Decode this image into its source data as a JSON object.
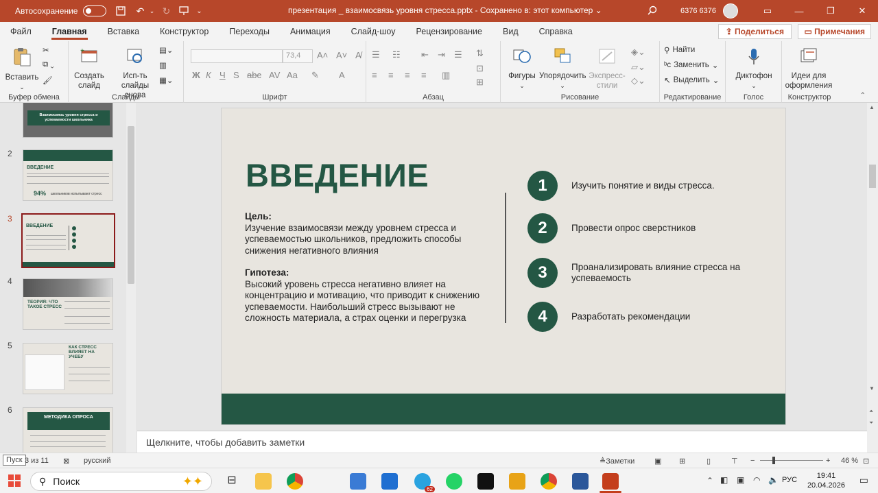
{
  "titlebar": {
    "autosave_label": "Автосохранение",
    "doc_title": "презентация _ взаимосвязь  уровня стресса.pptx  -  Сохранено в: этот компьютер ⌄",
    "user": "6376 6376"
  },
  "menu": {
    "tabs": [
      "Файл",
      "Главная",
      "Вставка",
      "Конструктор",
      "Переходы",
      "Анимация",
      "Слайд-шоу",
      "Рецензирование",
      "Вид",
      "Справка"
    ],
    "share": "Поделиться",
    "notes": "Примечания"
  },
  "ribbon": {
    "paste": "Вставить",
    "clipboard_group": "Буфер обмена",
    "new_slide": "Создать слайд",
    "reuse": "Исп-ть слайды снова",
    "slides_group": "Слайды",
    "font_size": "73,4",
    "font_group": "Шрифт",
    "paragraph_group": "Абзац",
    "shapes": "Фигуры",
    "arrange": "Упорядочить",
    "quick_styles": "Экспресс-стили",
    "drawing_group": "Рисование",
    "find": "Найти",
    "replace": "Заменить",
    "select": "Выделить",
    "editing_group": "Редактирование",
    "dictate": "Диктофон",
    "voice_group": "Голос",
    "designer": "Идеи для оформления",
    "designer_group": "Конструктор"
  },
  "thumbnails": {
    "slide1_title": "Взаимосвязь уровня стресса и успеваемости школьника",
    "slide2_title": "ВВЕДЕНИЕ",
    "slide2_stat": "94%",
    "slide2_stat_text": "школьников испытывают стресс",
    "slide3_title": "ВВЕДЕНИЕ",
    "slide4_title": "ТЕОРИЯ: ЧТО ТАКОЕ СТРЕСС",
    "slide5_title": "КАК СТРЕСС ВЛИЯЕТ НА УЧЕБУ",
    "slide6_title": "МЕТОДИКА ОПРОСА",
    "numbers": [
      "2",
      "3",
      "4",
      "5",
      "6"
    ]
  },
  "slide": {
    "title": "ВВЕДЕНИЕ",
    "goal_label": "Цель:",
    "goal_text": "Изучение взаимосвязи между уровнем стресса и успеваемостью школьников, предложить способы снижения негативного влияния",
    "hyp_label": "Гипотеза:",
    "hyp_text": "Высокий уровень стресса негативно влияет на концентрацию и мотивацию, что приводит к снижению успеваемости. Наибольший стресс вызывают не сложность материала, а страх оценки и перегрузка",
    "steps": [
      {
        "n": "1",
        "text": "Изучить понятие и виды стресса."
      },
      {
        "n": "2",
        "text": "Провести опрос сверстников"
      },
      {
        "n": "3",
        "text": "Проанализировать влияние стресса на успеваемость"
      },
      {
        "n": "4",
        "text": "Разработать рекомендации"
      }
    ],
    "accent": "#245744"
  },
  "notes_placeholder": "Щелкните, чтобы добавить заметки",
  "status": {
    "start_tooltip": "Пуск",
    "slide_counter": "3 из 11",
    "language": "русский",
    "notes_btn": "Заметки",
    "zoom": "46 %"
  },
  "taskbar": {
    "search": "Поиск",
    "lang": "РУС",
    "time": "19:41",
    "date": "20.04.2026",
    "telegram_badge": "62"
  }
}
